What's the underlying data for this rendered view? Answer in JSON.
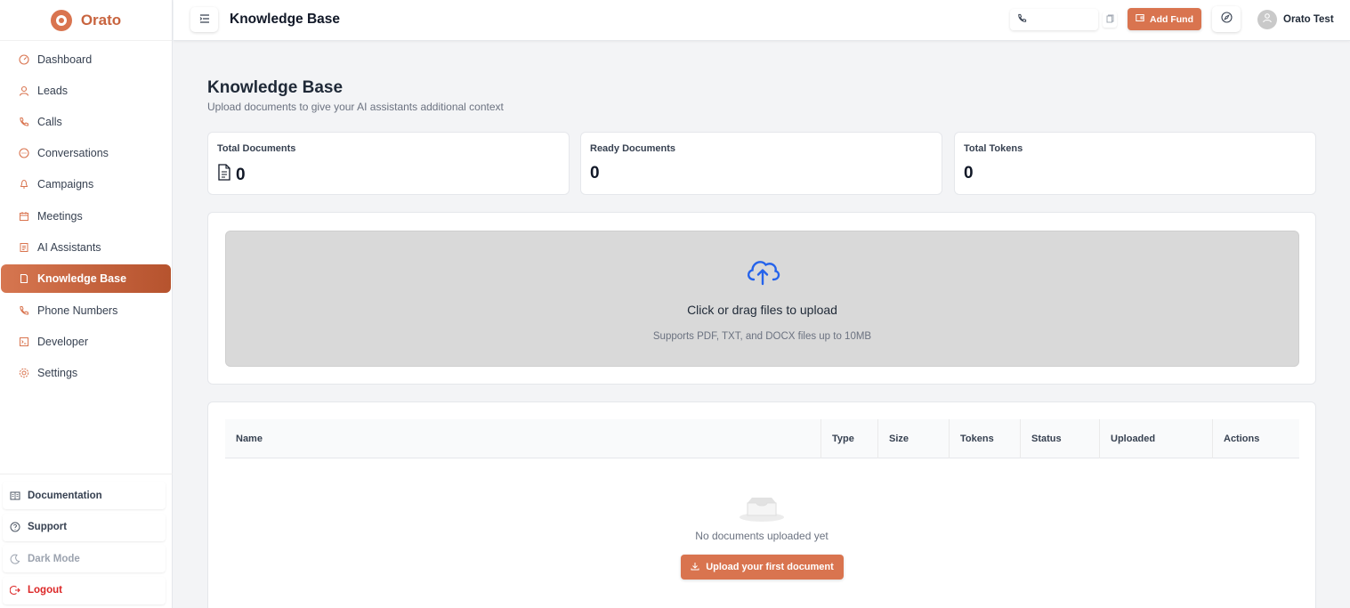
{
  "brand": {
    "name": "Orato",
    "accent": "#d9744f"
  },
  "sidebar": {
    "items": [
      {
        "label": "Dashboard",
        "icon": "gauge-icon"
      },
      {
        "label": "Leads",
        "icon": "user-icon"
      },
      {
        "label": "Calls",
        "icon": "phone-icon"
      },
      {
        "label": "Conversations",
        "icon": "chat-icon"
      },
      {
        "label": "Campaigns",
        "icon": "megaphone-icon"
      },
      {
        "label": "Meetings",
        "icon": "calendar-icon"
      },
      {
        "label": "AI Assistants",
        "icon": "bot-icon"
      },
      {
        "label": "Knowledge Base",
        "icon": "book-icon",
        "active": true
      },
      {
        "label": "Phone Numbers",
        "icon": "phone-icon"
      },
      {
        "label": "Developer",
        "icon": "terminal-icon"
      },
      {
        "label": "Settings",
        "icon": "gear-icon"
      }
    ],
    "bottom": {
      "documentation": "Documentation",
      "support": "Support",
      "dark_mode": "Dark Mode",
      "logout": "Logout"
    }
  },
  "header": {
    "title": "Knowledge Base",
    "add_fund": "Add Fund",
    "user_name": "Orato Test"
  },
  "main": {
    "title": "Knowledge Base",
    "subtitle": "Upload documents to give your AI assistants additional context",
    "stats": [
      {
        "label": "Total Documents",
        "value": "0"
      },
      {
        "label": "Ready Documents",
        "value": "0"
      },
      {
        "label": "Total Tokens",
        "value": "0"
      }
    ],
    "upload": {
      "title": "Click or drag files to upload",
      "subtitle": "Supports PDF, TXT, and DOCX files up to 10MB"
    },
    "table": {
      "columns": [
        "Name",
        "Type",
        "Size",
        "Tokens",
        "Status",
        "Uploaded",
        "Actions"
      ],
      "empty_text": "No documents uploaded yet",
      "empty_button": "Upload your first document"
    }
  }
}
